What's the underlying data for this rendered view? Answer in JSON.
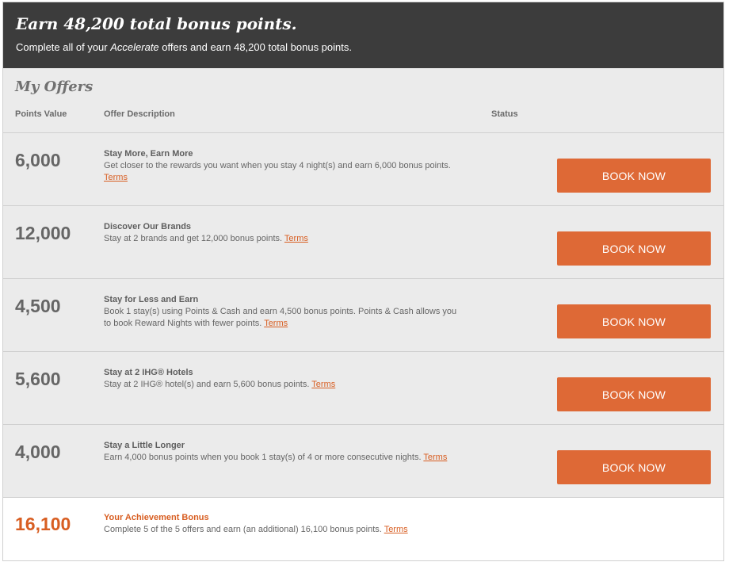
{
  "header": {
    "title": "Earn 48,200 total bonus points.",
    "sub_prefix": "Complete all of your ",
    "sub_emph": "Accelerate",
    "sub_suffix": " offers and earn 48,200 total bonus points."
  },
  "offers": {
    "heading": "My Offers",
    "columns": {
      "points": "Points Value",
      "description": "Offer Description",
      "status": "Status"
    },
    "items": [
      {
        "points": "6,000",
        "title": "Stay More, Earn More",
        "text": "Get closer to the rewards you want when you stay 4 night(s) and earn 6,000 bonus points.",
        "terms": "Terms",
        "button": "BOOK NOW"
      },
      {
        "points": "12,000",
        "title": "Discover Our Brands",
        "text": "Stay at 2 brands and get 12,000 bonus points.",
        "terms": "Terms",
        "button": "BOOK NOW"
      },
      {
        "points": "4,500",
        "title": "Stay for Less and Earn",
        "text": "Book 1 stay(s) using Points & Cash and earn 4,500 bonus points. Points & Cash allows you to book Reward Nights with fewer points.",
        "terms": "Terms",
        "button": "BOOK NOW"
      },
      {
        "points": "5,600",
        "title": "Stay at 2 IHG® Hotels",
        "text": "Stay at 2 IHG® hotel(s) and earn 5,600 bonus points.",
        "terms": "Terms",
        "button": "BOOK NOW"
      },
      {
        "points": "4,000",
        "title": "Stay a Little Longer",
        "text": "Earn 4,000 bonus points when you book 1 stay(s) of 4 or more consecutive nights.",
        "terms": "Terms",
        "button": "BOOK NOW"
      }
    ],
    "bonus": {
      "points": "16,100",
      "title": "Your Achievement Bonus",
      "text": "Complete 5 of the 5 offers and earn (an additional) 16,100 bonus points.",
      "terms": "Terms"
    }
  },
  "colors": {
    "header_bg": "#3c3c3c",
    "panel_bg": "#ebebeb",
    "accent": "#de6936",
    "link": "#d85e22"
  }
}
